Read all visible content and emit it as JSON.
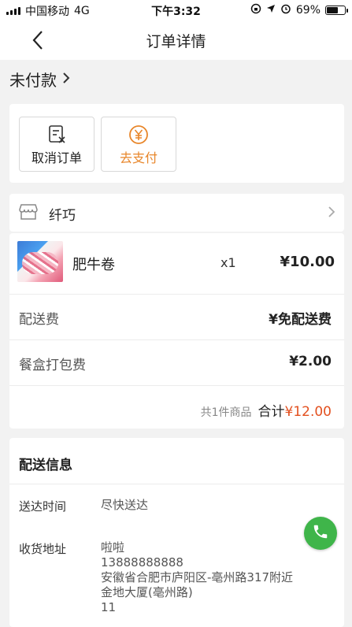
{
  "status_bar": {
    "carrier": "中国移动",
    "network": "4G",
    "time": "下午3:32",
    "battery": "69%",
    "battery_level": 0.69
  },
  "nav": {
    "title": "订单详情",
    "back_icon": "back-arrow-icon"
  },
  "order": {
    "status": "未付款",
    "actions": [
      {
        "label": "取消订单",
        "icon": "cancel-order-icon",
        "color": "#222222"
      },
      {
        "label": "去支付",
        "icon": "yuan-coin-icon",
        "color": "#e8862a"
      }
    ]
  },
  "shop": {
    "name": "纤巧",
    "icon": "shop-icon"
  },
  "items": [
    {
      "name": "肥牛卷",
      "qty": "x1",
      "price": "¥10.00"
    }
  ],
  "fees": [
    {
      "label": "配送费",
      "value": "¥免配送费"
    },
    {
      "label": "餐盒打包费",
      "value": "¥2.00"
    }
  ],
  "summary": {
    "count": "共1件商品",
    "total_label": "合计",
    "total_value": "¥12.00"
  },
  "delivery": {
    "title": "配送信息",
    "time_label": "送达时间",
    "time_value": "尽快送达",
    "address_label": "收货地址",
    "name": "啦啦",
    "phone": "13888888888",
    "address_line1": "安徽省合肥市庐阳区-亳州路317附近",
    "address_line2": "金地大厦(亳州路)",
    "address_line3": "11"
  },
  "colors": {
    "accent": "#e8862a",
    "total": "#e3501f",
    "call": "#3fb54a"
  }
}
